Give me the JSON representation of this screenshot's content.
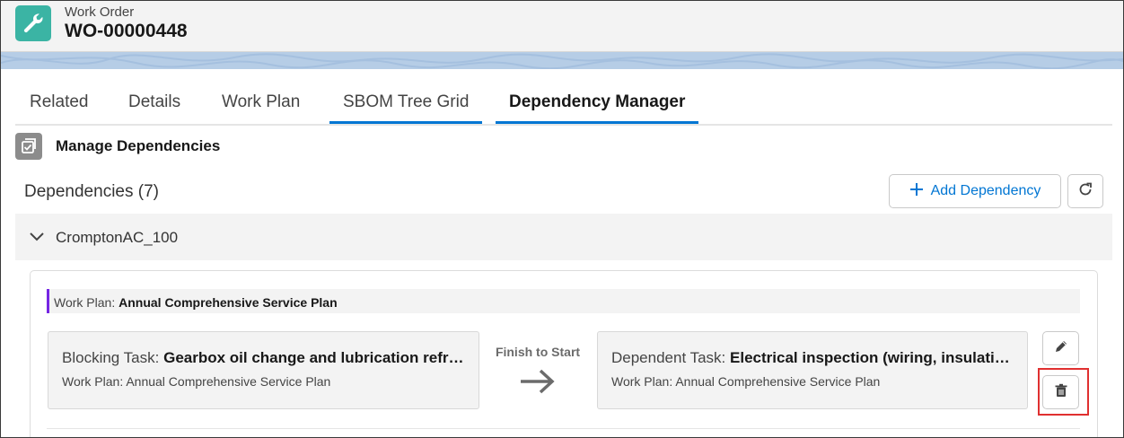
{
  "header": {
    "object_type": "Work Order",
    "record_name": "WO-00000448",
    "icon": "wrench-icon",
    "icon_color": "#3bb4a4"
  },
  "tabs": [
    {
      "label": "Related",
      "active": false
    },
    {
      "label": "Details",
      "active": false
    },
    {
      "label": "Work Plan",
      "active": false
    },
    {
      "label": "SBOM Tree Grid",
      "active": false,
      "underlined": true
    },
    {
      "label": "Dependency Manager",
      "active": true
    }
  ],
  "section": {
    "icon": "checklist-icon",
    "title": "Manage Dependencies"
  },
  "dependencies": {
    "heading": "Dependencies (7)",
    "add_button_label": "Add Dependency",
    "add_icon": "plus-icon",
    "refresh_icon": "refresh-icon"
  },
  "group": {
    "name": "CromptonAC_100",
    "expanded": true
  },
  "dependency_item": {
    "work_plan_label": "Work Plan:",
    "work_plan_value": "Annual Comprehensive Service Plan",
    "blocking": {
      "label": "Blocking Task:",
      "value": "Gearbox oil change and lubrication refr…",
      "sub": "Work Plan: Annual Comprehensive Service Plan"
    },
    "relationship": "Finish to Start",
    "dependent": {
      "label": "Dependent Task:",
      "value": "Electrical inspection (wiring, insulati…",
      "sub": "Work Plan: Annual Comprehensive Service Plan"
    },
    "edit_icon": "pencil-icon",
    "delete_icon": "trash-icon"
  },
  "colors": {
    "brand": "#0176d3",
    "highlight": "#e03030",
    "work_plan_accent": "#7526e3"
  }
}
